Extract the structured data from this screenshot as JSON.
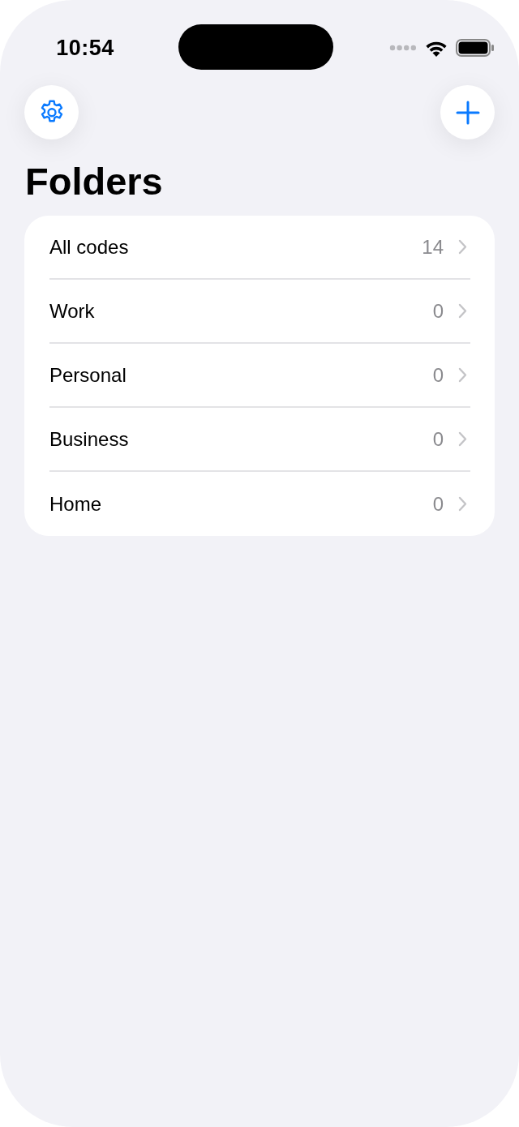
{
  "status_bar": {
    "time": "10:54"
  },
  "title": "Folders",
  "folders": [
    {
      "label": "All codes",
      "count": "14"
    },
    {
      "label": "Work",
      "count": "0"
    },
    {
      "label": "Personal",
      "count": "0"
    },
    {
      "label": "Business",
      "count": "0"
    },
    {
      "label": "Home",
      "count": "0"
    }
  ]
}
